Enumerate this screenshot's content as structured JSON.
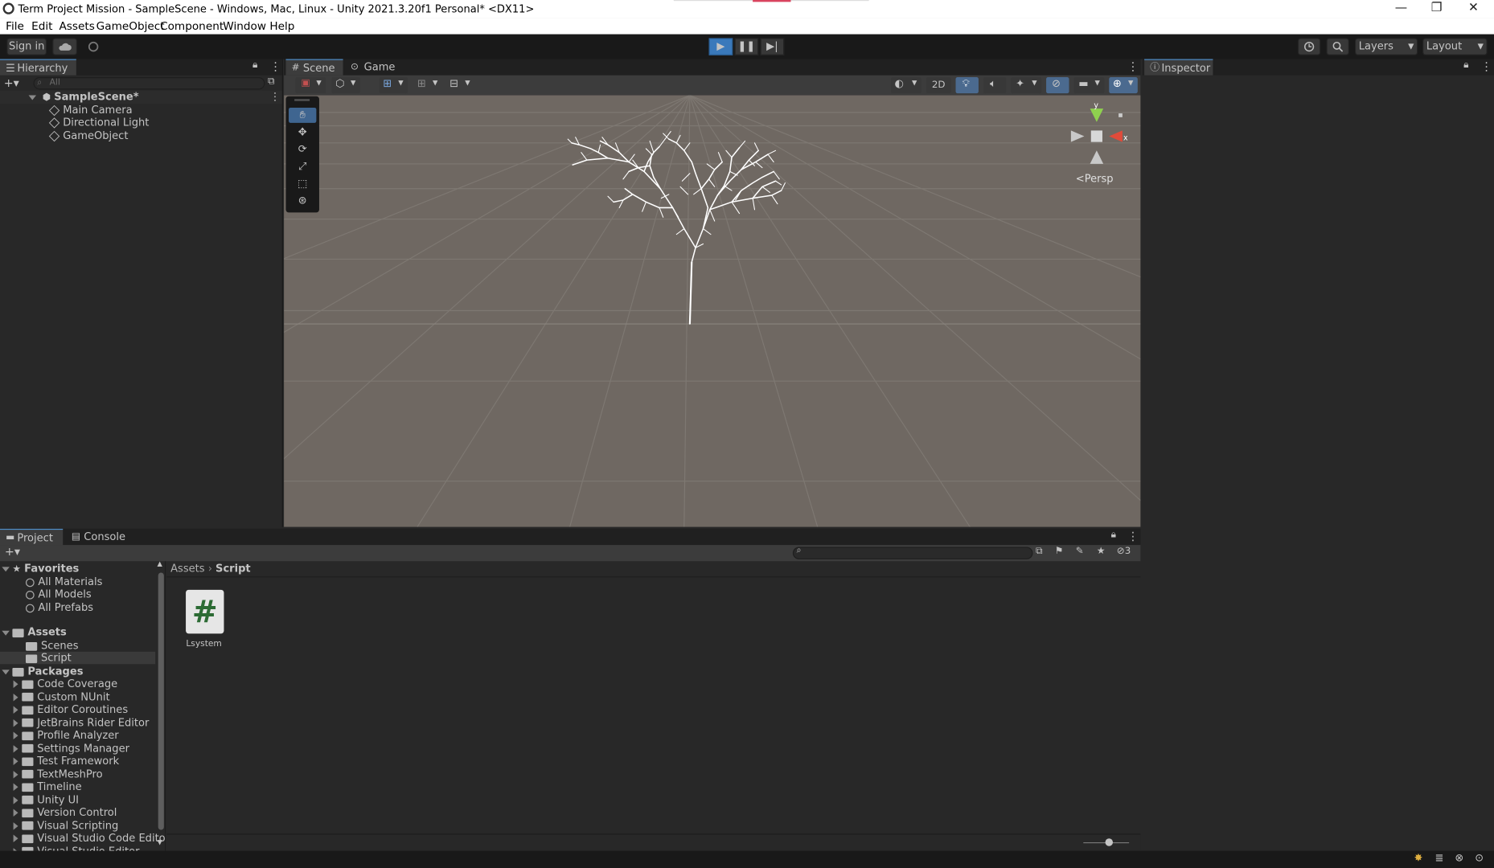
{
  "window": {
    "title": "Term Project Mission - SampleScene - Windows, Mac, Linux - Unity 2021.3.20f1 Personal* <DX11>",
    "minimize": "—",
    "restore": "❐",
    "close": "✕"
  },
  "menu": [
    "File",
    "Edit",
    "Assets",
    "GameObject",
    "Component",
    "Window",
    "Help"
  ],
  "toolbar": {
    "sign_in": "Sign in",
    "play": "▶",
    "pause": "❚❚",
    "step": "▶|",
    "layers": "Layers",
    "layout": "Layout"
  },
  "hierarchy": {
    "tab": "Hierarchy",
    "search_placeholder": "All",
    "scene": "SampleScene*",
    "items": [
      "Main Camera",
      "Directional Light",
      "GameObject"
    ]
  },
  "scene_view": {
    "tabs": [
      "Scene",
      "Game"
    ],
    "mode_2d": "2D",
    "persp_label": "Persp",
    "gizmo_axis_x": "x",
    "gizmo_axis_y": "y"
  },
  "inspector": {
    "tab": "Inspector"
  },
  "project": {
    "tabs": [
      "Project",
      "Console"
    ],
    "hidden_count": "3",
    "breadcrumb": [
      "Assets",
      "Script"
    ],
    "favorites_label": "Favorites",
    "favorites": [
      "All Materials",
      "All Models",
      "All Prefabs"
    ],
    "assets_label": "Assets",
    "assets": [
      "Scenes",
      "Script"
    ],
    "packages_label": "Packages",
    "packages": [
      "Code Coverage",
      "Custom NUnit",
      "Editor Coroutines",
      "JetBrains Rider Editor",
      "Profile Analyzer",
      "Settings Manager",
      "Test Framework",
      "TextMeshPro",
      "Timeline",
      "Unity UI",
      "Version Control",
      "Visual Scripting",
      "Visual Studio Code Editor",
      "Visual Studio Editor"
    ],
    "file_name": "Lsystem",
    "file_glyph": "#"
  },
  "colors": {
    "editor_bg": "#282828",
    "toolbar_bg": "#191919",
    "scene_bg": "#6f6862",
    "accent": "#3a79bb",
    "script_icon": "#2c6b34"
  }
}
